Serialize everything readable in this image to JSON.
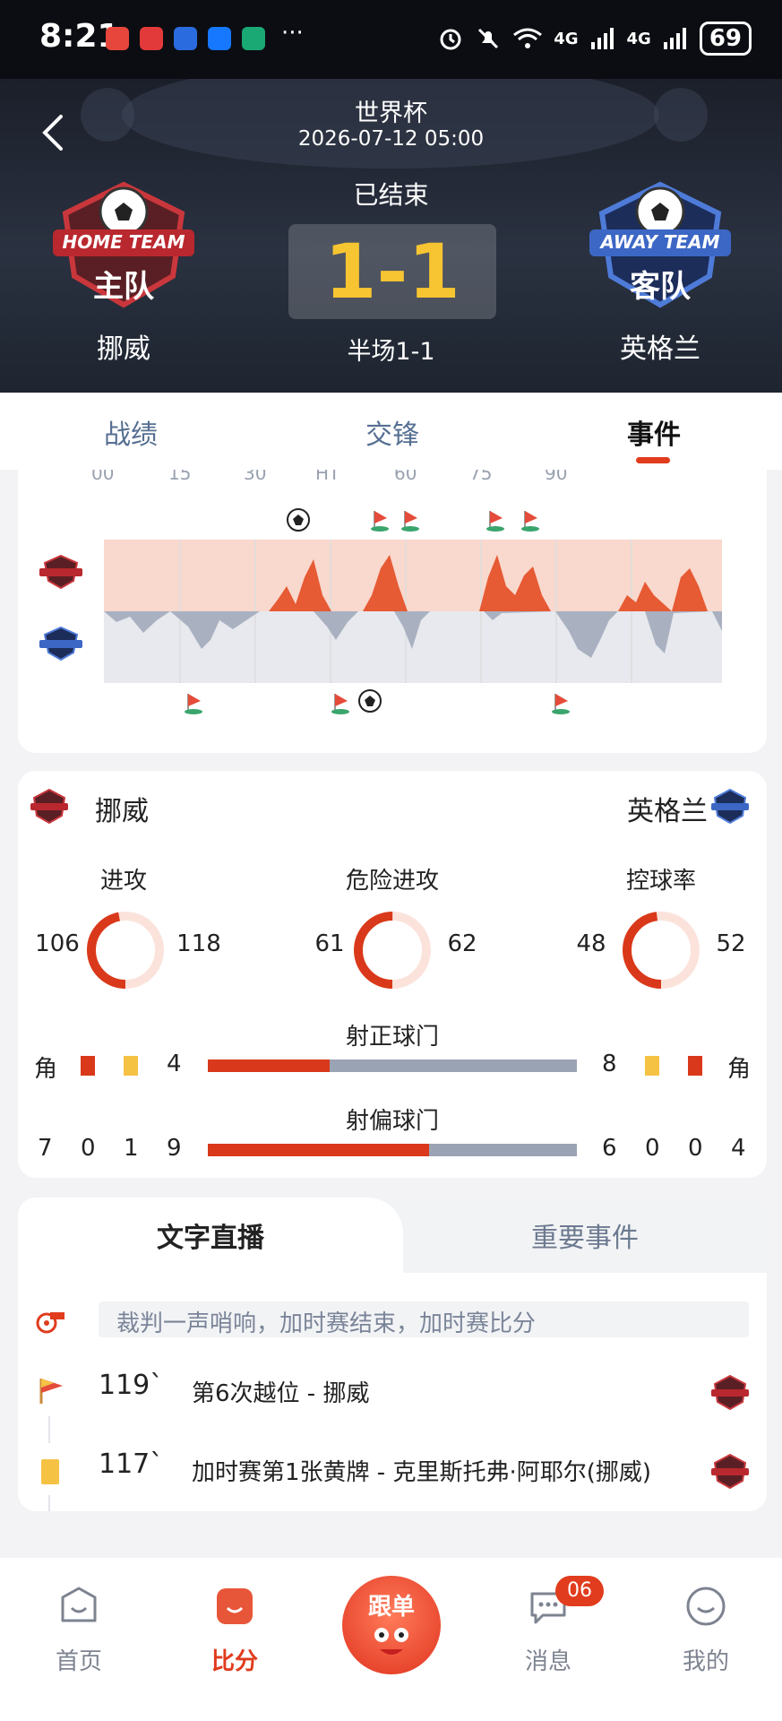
{
  "statusbar": {
    "time": "8:21",
    "battery": "69",
    "net1": "4G",
    "net2": "4G",
    "more": "···"
  },
  "header": {
    "league": "世界杯",
    "datetime": "2026-07-12 05:00",
    "status": "已结束",
    "score": "1-1",
    "halftime": "半场1-1",
    "home": {
      "name": "挪威",
      "badge_text": "HOME TEAM",
      "badge_cn": "主队"
    },
    "away": {
      "name": "英格兰",
      "badge_text": "AWAY TEAM",
      "badge_cn": "客队"
    }
  },
  "tabs": [
    "战绩",
    "交锋",
    "事件"
  ],
  "chart": {
    "ticks": [
      "00",
      "15",
      "30",
      "HT",
      "60",
      "75",
      "90"
    ]
  },
  "stats": {
    "home_name": "挪威",
    "away_name": "英格兰",
    "circles": [
      {
        "label": "进攻",
        "home": "106",
        "away": "118",
        "home_fraction": 0.47
      },
      {
        "label": "危险进攻",
        "home": "61",
        "away": "62",
        "home_fraction": 0.5
      },
      {
        "label": "控球率",
        "home": "48",
        "away": "52",
        "home_fraction": 0.48
      }
    ],
    "shots_on": {
      "label": "射正球门",
      "home": "4",
      "away": "8",
      "home_fraction": 0.33
    },
    "shots_off": {
      "label": "射偏球门",
      "home": "9",
      "away": "4",
      "home_fraction": 0.6
    },
    "corner_label": "角",
    "home_row2": [
      "7",
      "0",
      "1"
    ],
    "away_row2": [
      "6",
      "0",
      "0"
    ],
    "colors": {
      "home": "#d9391a",
      "away": "#9aa3b4",
      "yellow": "#f5c244"
    }
  },
  "live": {
    "tab_active": "文字直播",
    "tab_inactive": "重要事件",
    "notice": "裁判一声哨响，加时赛结束，加时赛比分",
    "events": [
      {
        "minute": "119`",
        "text": "第6次越位 - 挪威"
      },
      {
        "minute": "117`",
        "text": "加时赛第1张黄牌 - 克里斯托弗·阿耶尔(挪威)"
      }
    ]
  },
  "nav": {
    "home": "首页",
    "score": "比分",
    "center": "跟单",
    "messages": "消息",
    "messages_badge": "06",
    "mine": "我的"
  }
}
